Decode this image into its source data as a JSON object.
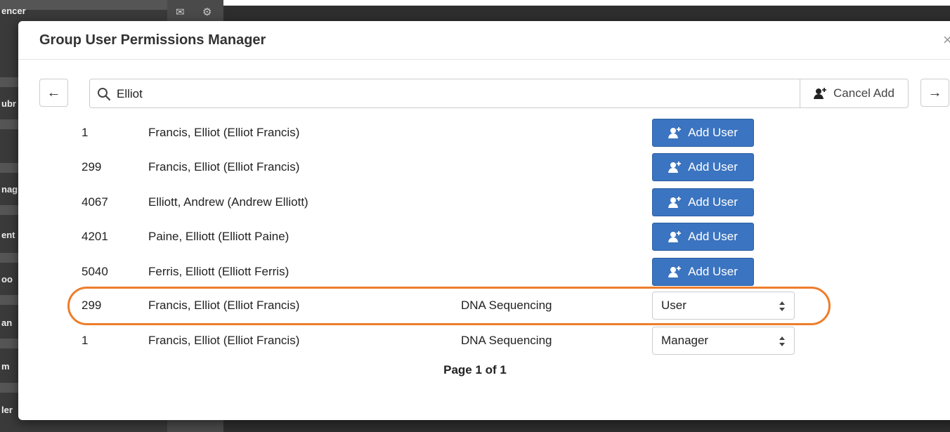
{
  "modal": {
    "title": "Group User Permissions Manager",
    "close_glyph": "×"
  },
  "nav": {
    "prev_icon": "arrow-left-icon",
    "next_icon": "arrow-right-icon"
  },
  "search": {
    "value": "Elliot",
    "icon": "search-icon",
    "cancel_label": "Cancel Add",
    "cancel_icon": "user-plus-icon"
  },
  "results": [
    {
      "id": "1",
      "name": "Francis, Elliot (Elliot Francis)",
      "action": "Add User"
    },
    {
      "id": "299",
      "name": "Francis, Elliot (Elliot Francis)",
      "action": "Add User"
    },
    {
      "id": "4067",
      "name": "Elliott, Andrew (Andrew Elliott)",
      "action": "Add User"
    },
    {
      "id": "4201",
      "name": "Paine, Elliott (Elliott Paine)",
      "action": "Add User"
    },
    {
      "id": "5040",
      "name": "Ferris, Elliott (Elliott Ferris)",
      "action": "Add User"
    }
  ],
  "members": [
    {
      "id": "299",
      "name": "Francis, Elliot (Elliot Francis)",
      "group": "DNA Sequencing",
      "role": "User",
      "highlighted": true
    },
    {
      "id": "1",
      "name": "Francis, Elliot (Elliot Francis)",
      "group": "DNA Sequencing",
      "role": "Manager",
      "highlighted": false
    }
  ],
  "pager": "Page 1 of 1",
  "colors": {
    "primary_button": "#3b74c0",
    "highlight": "#ee7d2b"
  },
  "background": {
    "sidebar_fragments": [
      "encer",
      "ubr",
      "nag",
      "ent",
      "oo",
      "an",
      "m",
      "ler"
    ],
    "icons": [
      "mail-icon",
      "gear-icon"
    ]
  }
}
